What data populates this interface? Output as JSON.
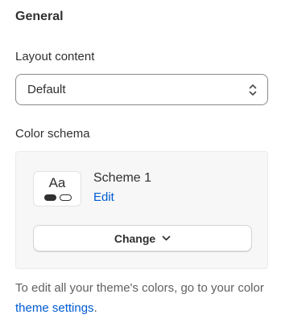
{
  "section": {
    "title": "General"
  },
  "layout": {
    "label": "Layout content",
    "selected": "Default",
    "icon": "select-chevrons-icon"
  },
  "color": {
    "label": "Color schema",
    "scheme": {
      "preview_text": "Aa",
      "name": "Scheme 1",
      "edit_label": "Edit"
    },
    "change_label": "Change",
    "change_icon": "chevron-down-icon"
  },
  "help": {
    "prefix": "To edit all your theme's colors, go to your color ",
    "link_text": "theme settings",
    "suffix": "."
  },
  "colors": {
    "link": "#005bd3",
    "text": "#303030",
    "muted": "#616161",
    "card_bg": "#f7f7f7"
  }
}
